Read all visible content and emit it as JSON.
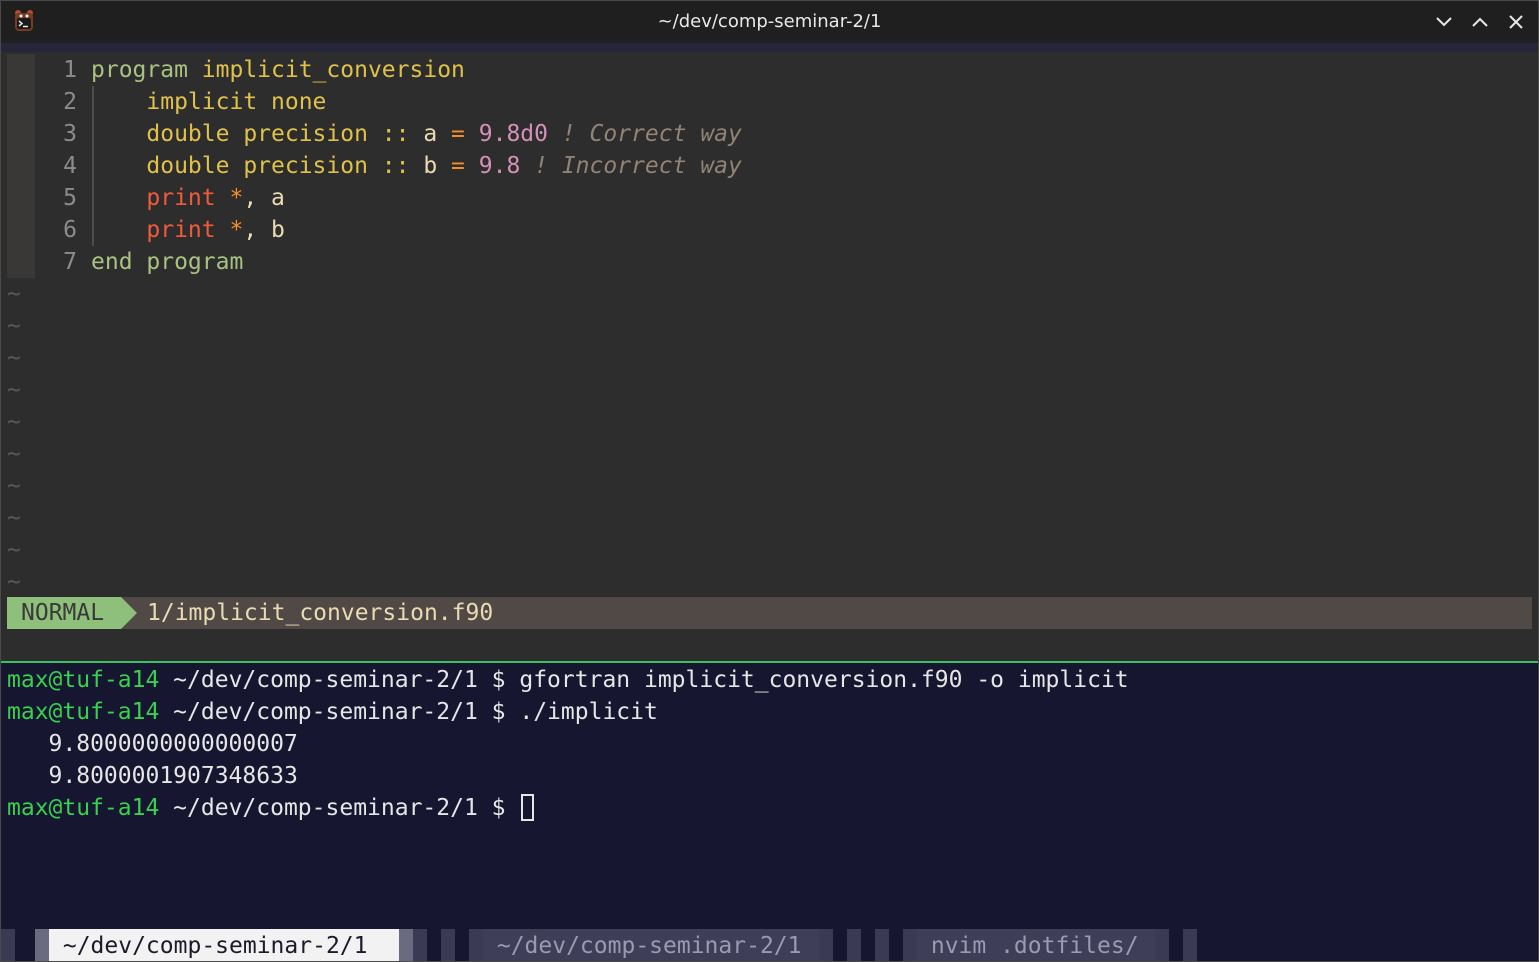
{
  "window": {
    "title": "~/dev/comp-seminar-2/1"
  },
  "editor": {
    "lines": [
      {
        "num": "1",
        "parts": [
          {
            "t": "program",
            "c": "k-green"
          },
          {
            "t": " ",
            "c": ""
          },
          {
            "t": "implicit_conversion",
            "c": "k-yellow"
          }
        ]
      },
      {
        "num": "2",
        "parts": [
          {
            "t": "    ",
            "c": ""
          },
          {
            "t": "implicit none",
            "c": "k-yellow"
          }
        ]
      },
      {
        "num": "3",
        "parts": [
          {
            "t": "    ",
            "c": ""
          },
          {
            "t": "double precision",
            "c": "k-yellow"
          },
          {
            "t": " :: ",
            "c": "k-yellow"
          },
          {
            "t": "a",
            "c": "k-white"
          },
          {
            "t": " = ",
            "c": "k-orange"
          },
          {
            "t": "9.8d0",
            "c": "k-pink"
          },
          {
            "t": " ! Correct way",
            "c": "k-comment"
          }
        ]
      },
      {
        "num": "4",
        "parts": [
          {
            "t": "    ",
            "c": ""
          },
          {
            "t": "double precision",
            "c": "k-yellow"
          },
          {
            "t": " :: ",
            "c": "k-yellow"
          },
          {
            "t": "b",
            "c": "k-white"
          },
          {
            "t": " = ",
            "c": "k-orange"
          },
          {
            "t": "9.8",
            "c": "k-pink"
          },
          {
            "t": " ! Incorrect way",
            "c": "k-comment"
          }
        ]
      },
      {
        "num": "5",
        "parts": [
          {
            "t": "    ",
            "c": ""
          },
          {
            "t": "print",
            "c": "k-red"
          },
          {
            "t": " *",
            "c": "k-orange"
          },
          {
            "t": ", a",
            "c": "k-white"
          }
        ]
      },
      {
        "num": "6",
        "parts": [
          {
            "t": "    ",
            "c": ""
          },
          {
            "t": "print",
            "c": "k-red"
          },
          {
            "t": " *",
            "c": "k-orange"
          },
          {
            "t": ", b",
            "c": "k-white"
          }
        ]
      },
      {
        "num": "7",
        "parts": [
          {
            "t": "end program",
            "c": "k-green"
          }
        ]
      }
    ],
    "empty_marker": "~",
    "empty_count": 10,
    "status": {
      "mode": "NORMAL",
      "file": "1/implicit_conversion.f90"
    }
  },
  "terminal": {
    "lines": [
      {
        "user": "max@tuf-a14",
        "path": " ~/dev/comp-seminar-2/1 $ ",
        "cmd": "gfortran implicit_conversion.f90 -o implicit"
      },
      {
        "user": "max@tuf-a14",
        "path": " ~/dev/comp-seminar-2/1 $ ",
        "cmd": "./implicit"
      },
      {
        "out": "   9.8000000000000007"
      },
      {
        "out": "   9.8000001907348633"
      },
      {
        "user": "max@tuf-a14",
        "path": " ~/dev/comp-seminar-2/1 $ ",
        "cmd": "",
        "cursor": true
      }
    ]
  },
  "tabs": [
    {
      "label": " ~/dev/comp-seminar-2/1 ",
      "active": true
    },
    {
      "label": " ~/dev/comp-seminar-2/1 ",
      "active": false
    },
    {
      "label": " nvim .dotfiles/ ",
      "active": false
    }
  ],
  "colors": {
    "accent_green": "#34c35f",
    "mode_bg": "#8ec07c",
    "status_bg": "#504945"
  },
  "icons": [
    "terminal-app-icon",
    "minimize-icon",
    "maximize-icon",
    "close-icon"
  ]
}
